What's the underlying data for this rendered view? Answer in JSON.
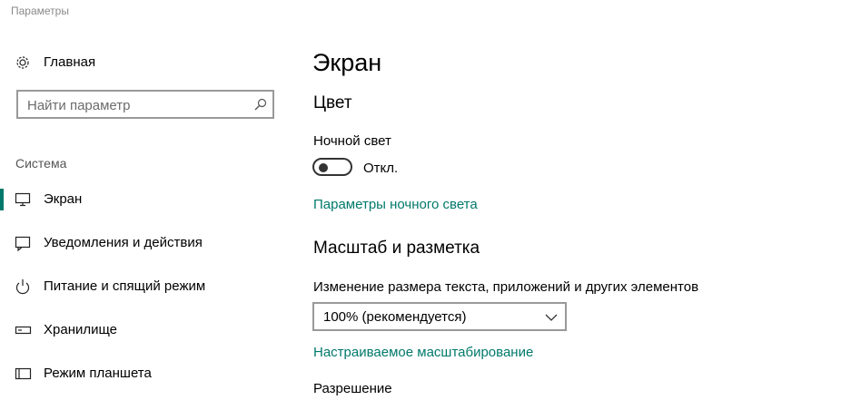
{
  "window": {
    "title": "Параметры"
  },
  "sidebar": {
    "home_label": "Главная",
    "search_placeholder": "Найти параметр",
    "section_header": "Система",
    "items": [
      {
        "label": "Экран",
        "icon": "monitor-icon",
        "selected": true
      },
      {
        "label": "Уведомления и действия",
        "icon": "notification-icon",
        "selected": false
      },
      {
        "label": "Питание и спящий режим",
        "icon": "power-icon",
        "selected": false
      },
      {
        "label": "Хранилище",
        "icon": "storage-icon",
        "selected": false
      },
      {
        "label": "Режим планшета",
        "icon": "tablet-icon",
        "selected": false
      }
    ]
  },
  "main": {
    "title": "Экран",
    "color_header": "Цвет",
    "night_light_label": "Ночной свет",
    "night_light_state": "Откл.",
    "night_light_settings_link": "Параметры ночного света",
    "scale_header": "Масштаб и разметка",
    "scale_label": "Изменение размера текста, приложений и других элементов",
    "scale_value": "100% (рекомендуется)",
    "custom_scaling_link": "Настраиваемое масштабирование",
    "resolution_label": "Разрешение"
  },
  "colors": {
    "accent": "#00796b"
  }
}
